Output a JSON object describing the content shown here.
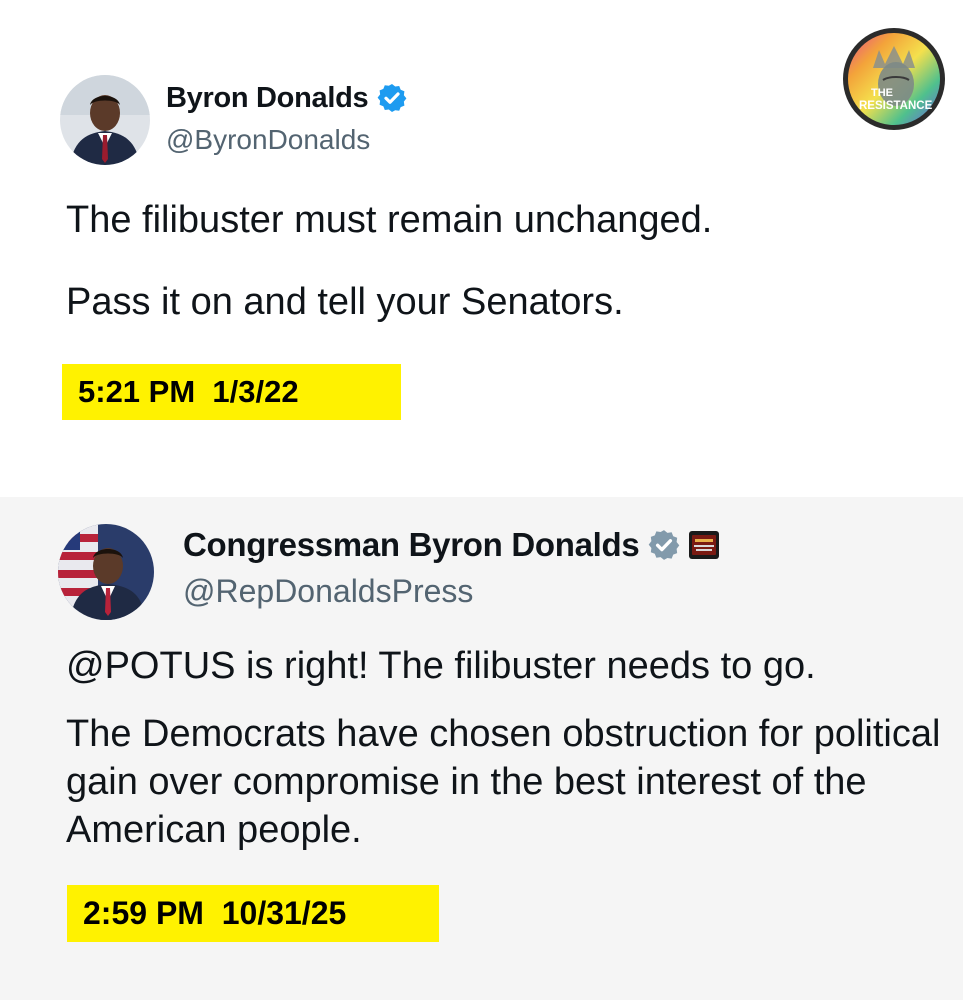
{
  "watermark": {
    "logo_text": [
      "THE",
      "RESISTANCE"
    ]
  },
  "tweets": [
    {
      "display_name": "Byron Donalds",
      "handle": "@ByronDonalds",
      "verified": "blue-check",
      "paragraphs": [
        "The filibuster must remain unchanged.",
        "Pass it on and tell your Senators."
      ],
      "timestamp": "5:21 PM  1/3/22"
    },
    {
      "display_name": "Congressman Byron Donalds",
      "handle": "@RepDonaldsPress",
      "verified": "gray-check",
      "paragraphs": [
        "@POTUS is right! The filibuster needs to go.",
        "The Democrats have chosen obstruction for political gain over compromise in the best interest of the American people."
      ],
      "timestamp": "2:59 PM  10/31/25"
    }
  ],
  "colors": {
    "highlight": "#fff200",
    "verified_blue": "#1d9bf0",
    "verified_gray": "#829aab",
    "handle_gray": "#536471"
  }
}
